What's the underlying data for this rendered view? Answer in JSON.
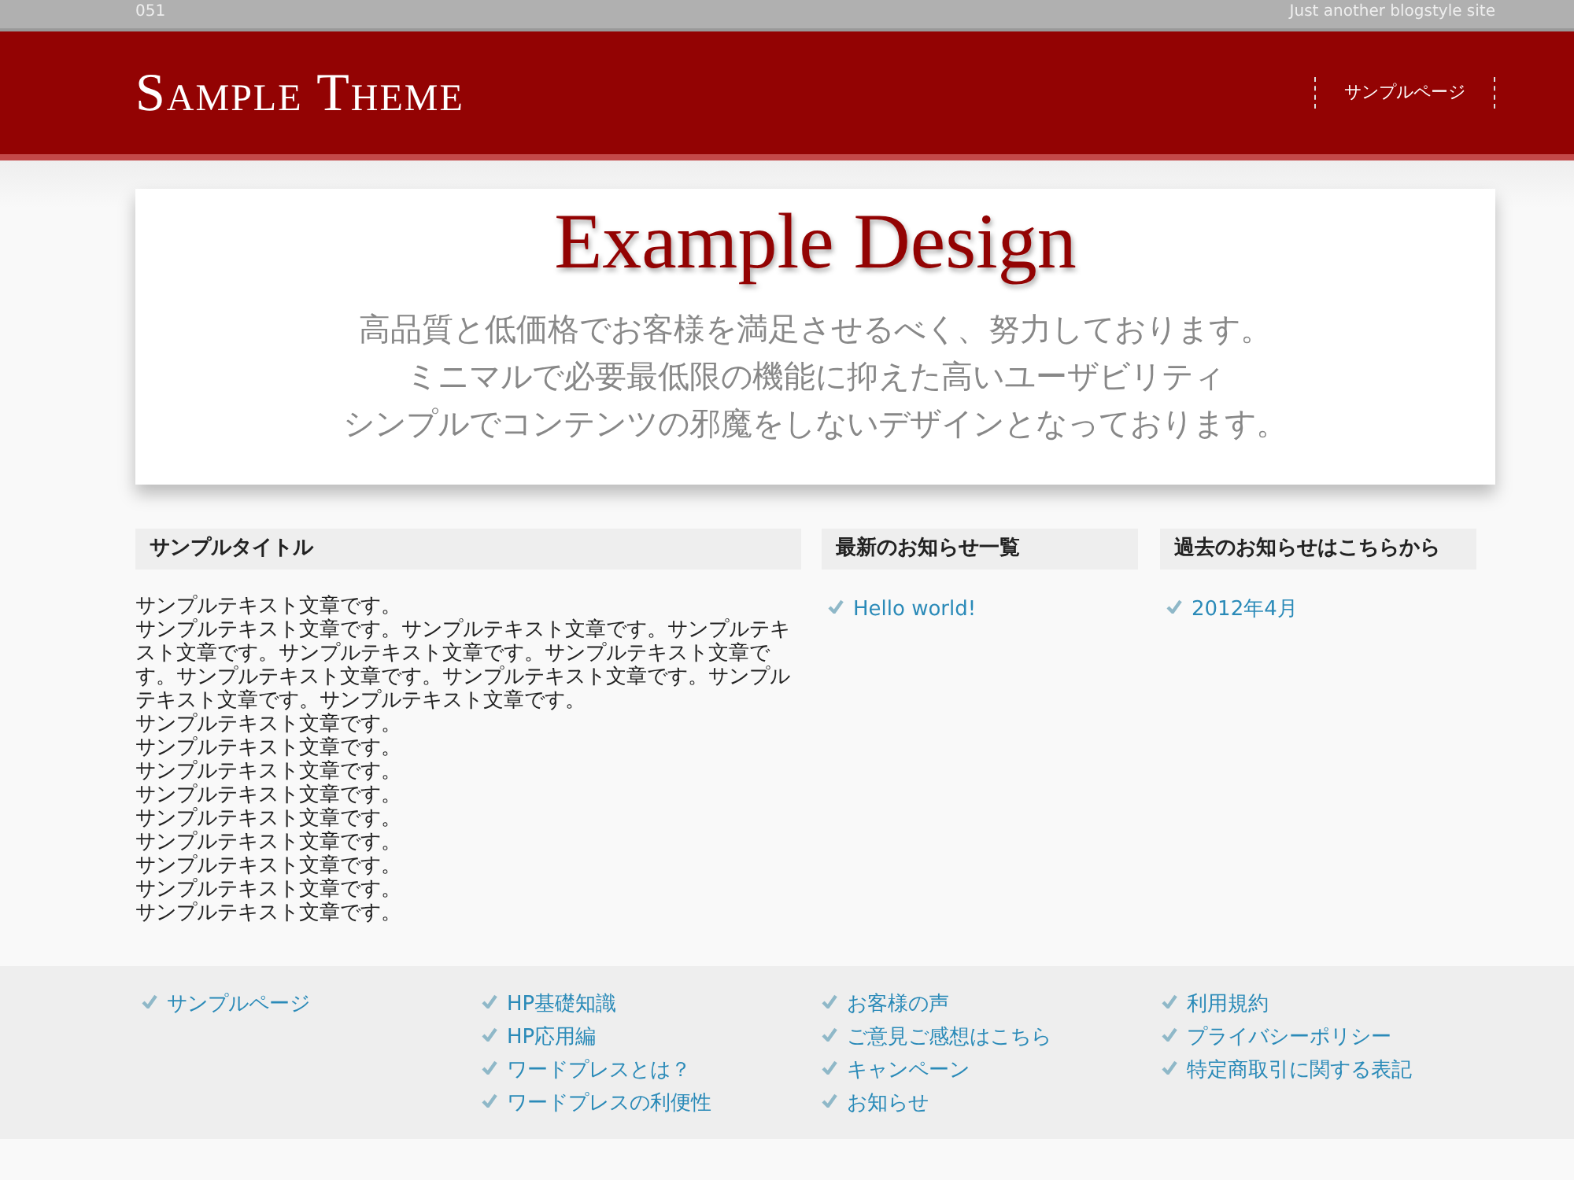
{
  "top_bar": {
    "left_text": "051",
    "tagline": "Just another blogstyle site"
  },
  "header": {
    "site_title": "Sample Theme",
    "nav": [
      {
        "label": "サンプルページ"
      }
    ]
  },
  "hero": {
    "title": "Example Design",
    "lines": [
      "高品質と低価格でお客様を満足させるべく、努力しております。",
      "ミニマルで必要最低限の機能に抑えた高いユーザビリティ",
      "シンプルでコンテンツの邪魔をしないデザインとなっております。"
    ]
  },
  "main": {
    "heading": "サンプルタイトル",
    "paragraphs": [
      "サンプルテキスト文章です。",
      "サンプルテキスト文章です。サンプルテキスト文章です。サンプルテキスト文章です。サンプルテキスト文章です。サンプルテキスト文章です。サンプルテキスト文章です。サンプルテキスト文章です。サンプルテキスト文章です。サンプルテキスト文章です。",
      "サンプルテキスト文章です。",
      "サンプルテキスト文章です。",
      "サンプルテキスト文章です。",
      "サンプルテキスト文章です。",
      "サンプルテキスト文章です。",
      "サンプルテキスト文章です。",
      "サンプルテキスト文章です。",
      "サンプルテキスト文章です。",
      "サンプルテキスト文章です。"
    ]
  },
  "widgets": [
    {
      "heading": "最新のお知らせ一覧",
      "links": [
        "Hello world!"
      ]
    },
    {
      "heading": "過去のお知らせはこちらから",
      "links": [
        "2012年4月"
      ]
    }
  ],
  "footer": {
    "columns": [
      [
        "サンプルページ"
      ],
      [
        "HP基礎知識",
        "HP応用編",
        "ワードプレスとは？",
        "ワードプレスの利便性"
      ],
      [
        "お客様の声",
        "ご意見ご感想はこちら",
        "キャンペーン",
        "お知らせ"
      ],
      [
        "利用規約",
        "プライバシーポリシー",
        "特定商取引に関する表記"
      ]
    ]
  }
}
